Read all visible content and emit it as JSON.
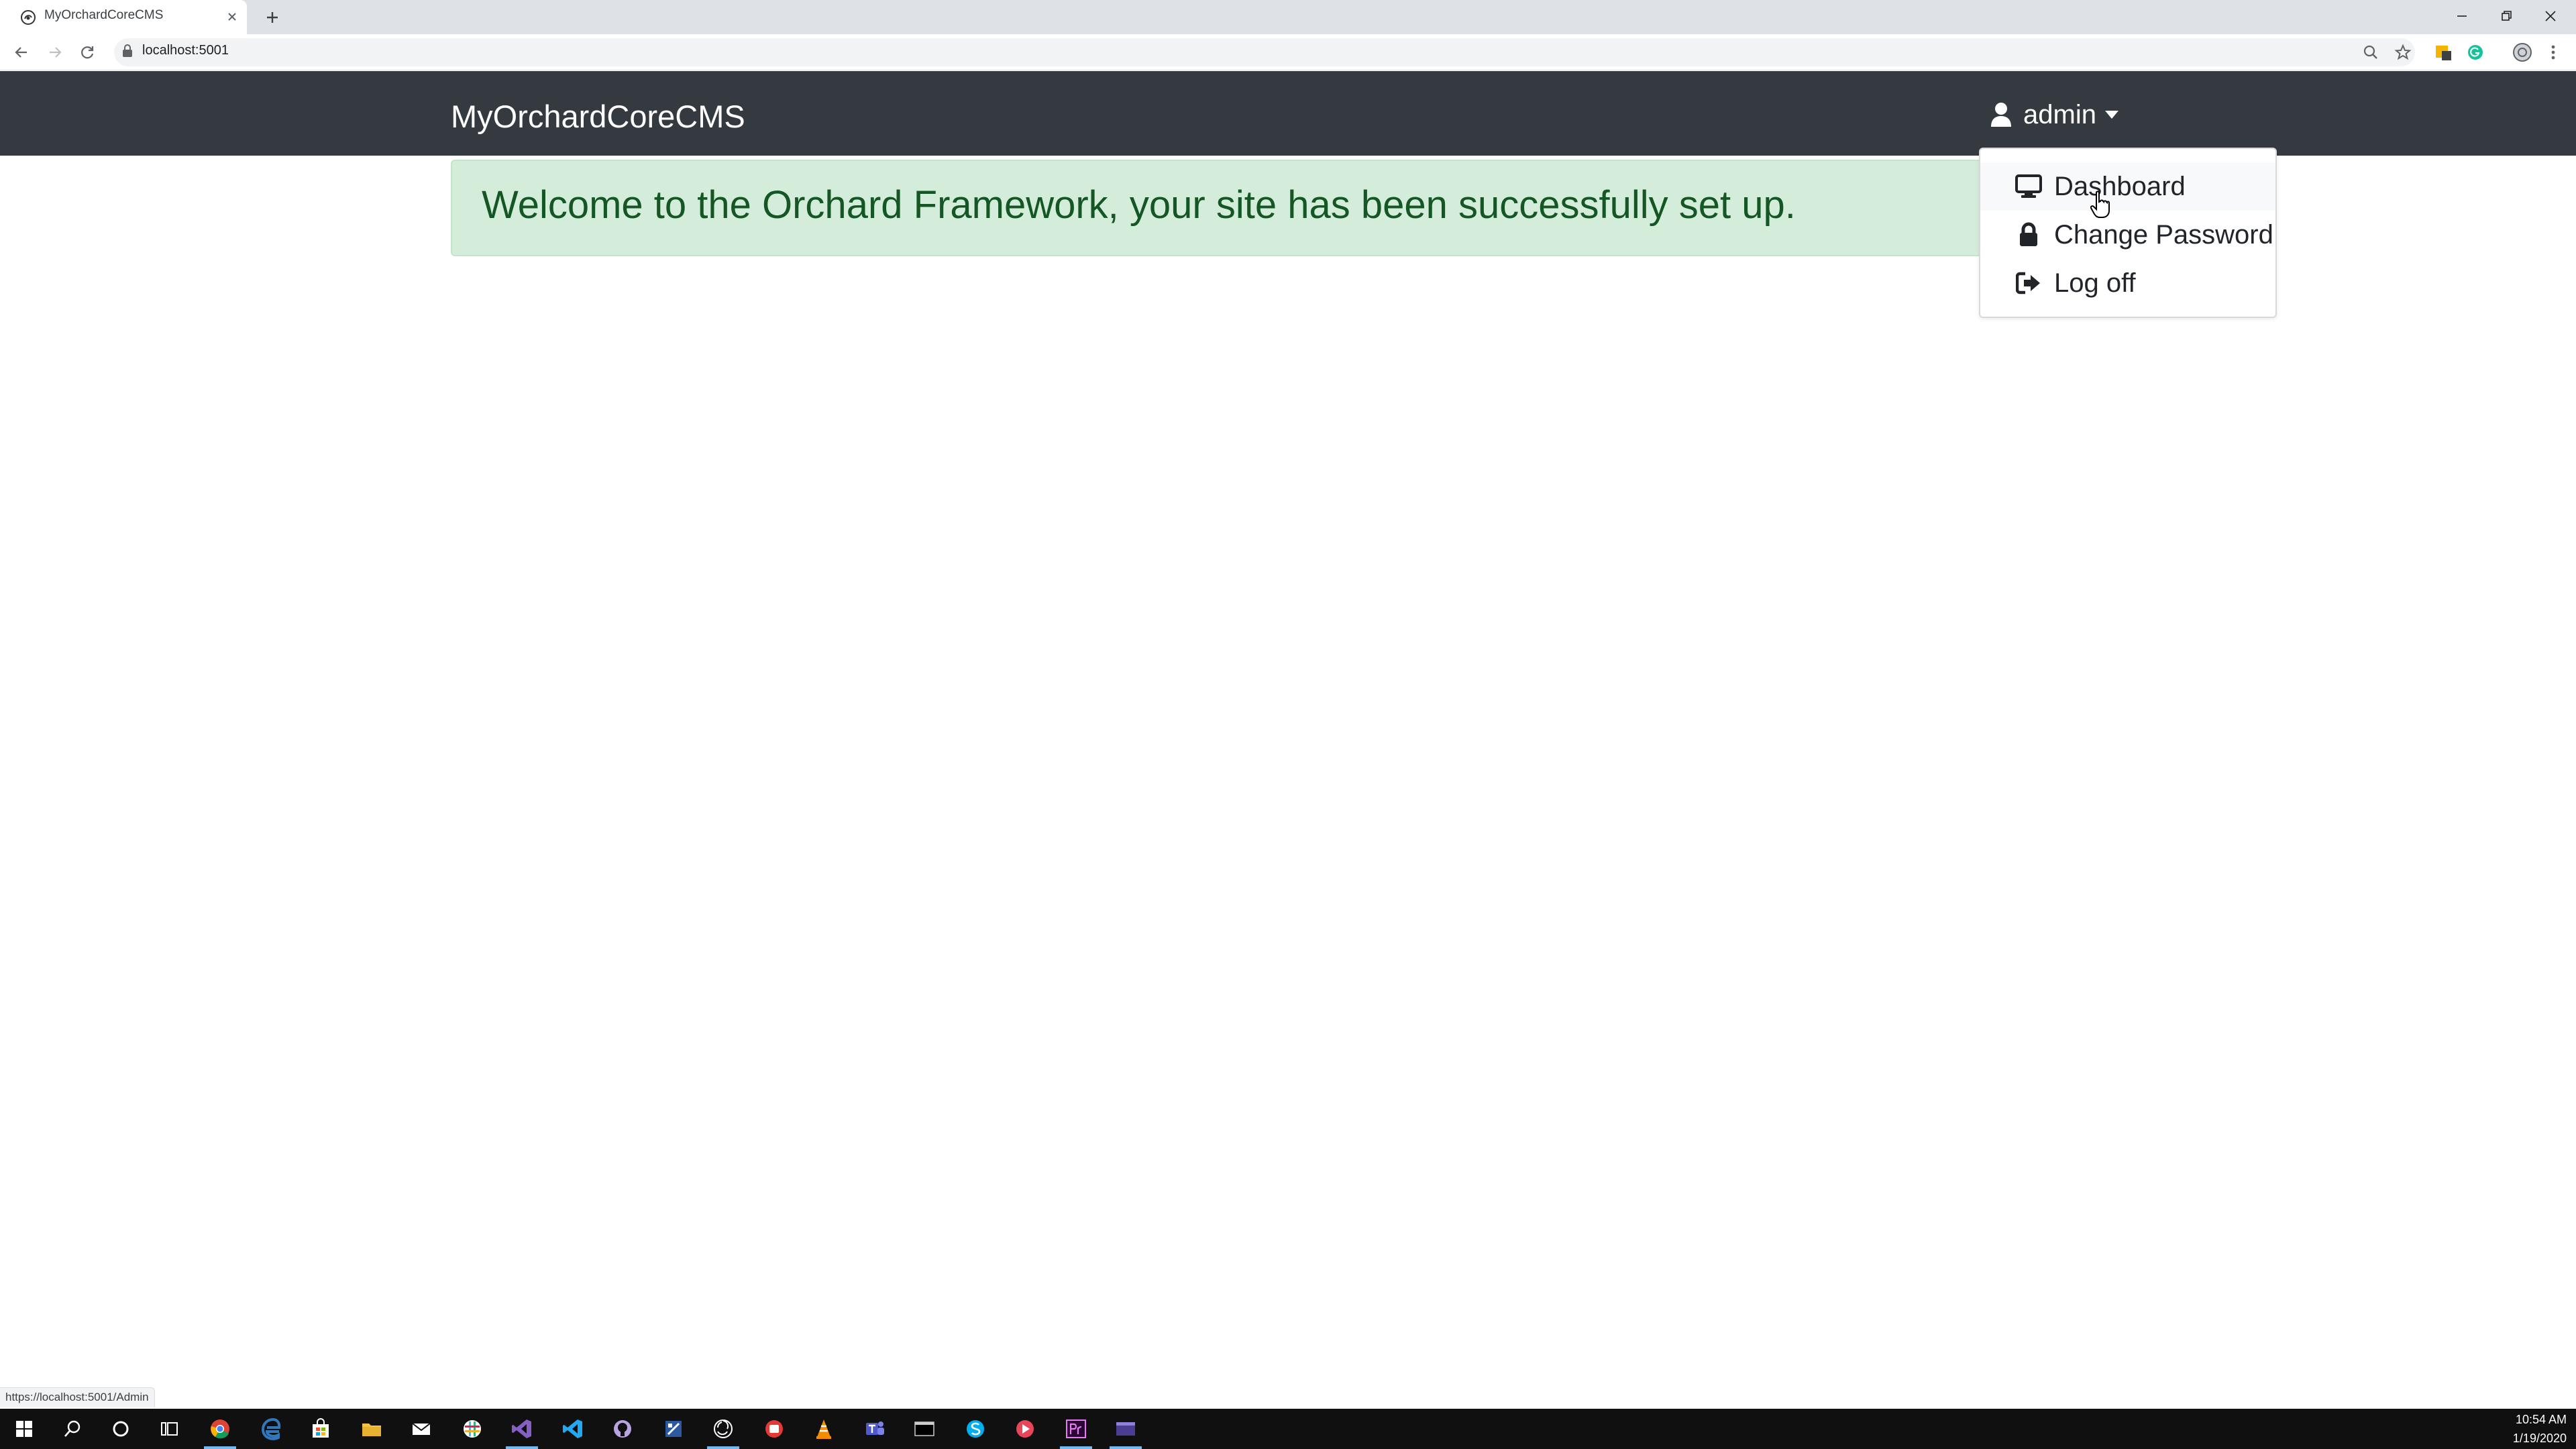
{
  "browser": {
    "tab_title": "MyOrchardCoreCMS",
    "url": "localhost:5001",
    "status_url": "https://localhost:5001/Admin"
  },
  "site": {
    "brand": "MyOrchardCoreCMS",
    "user_menu_label": "admin",
    "alert_message": "Welcome to the Orchard Framework, your site has been successfully set up.",
    "dropdown_items": [
      {
        "label": "Dashboard",
        "icon": "desktop-icon"
      },
      {
        "label": "Change Password",
        "icon": "lock-icon"
      },
      {
        "label": "Log off",
        "icon": "sign-out-icon"
      }
    ]
  },
  "taskbar": {
    "time": "10:54 AM",
    "date": "1/19/2020"
  },
  "colors": {
    "navbar": "#343a40",
    "alert_bg": "#d4edda",
    "alert_text": "#155724",
    "taskbar": "#101010"
  }
}
